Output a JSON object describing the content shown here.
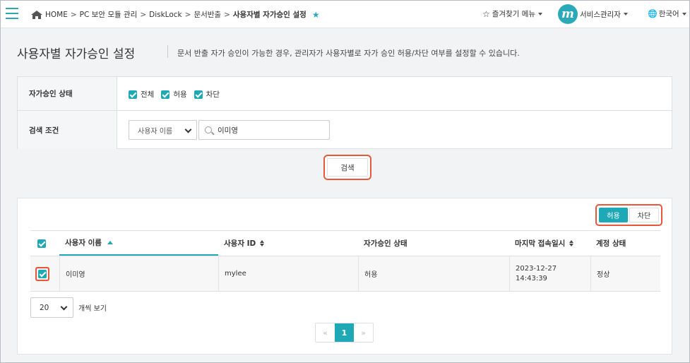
{
  "topbar": {
    "breadcrumb": [
      "HOME",
      "PC 보안 모듈 관리",
      "DiskLock",
      "문서반출",
      "사용자별 자가승인 설정"
    ],
    "breadcrumb_sep": ">",
    "favorites_label": "즐겨찾기 메뉴",
    "user_label": "서비스관리자",
    "avatar_letter": "m",
    "language_label": "한국어"
  },
  "page": {
    "title": "사용자별 자가승인 설정",
    "description": "문서 반출 자가 승인이 가능한 경우, 관리자가 사용자별로 자가 승인 허용/차단 여부를 설정할 수 있습니다."
  },
  "filter": {
    "status_label": "자가승인 상태",
    "status_options": [
      {
        "label": "전체",
        "checked": true
      },
      {
        "label": "허용",
        "checked": true
      },
      {
        "label": "차단",
        "checked": true
      }
    ],
    "condition_label": "검색 조건",
    "condition_select": "사용자 이름",
    "search_value": "이미영",
    "search_button": "검색"
  },
  "results": {
    "allow_button": "허용",
    "block_button": "차단",
    "columns": [
      "사용자 이름",
      "사용자 ID",
      "자가승인 상태",
      "마지막 접속일시",
      "계정 상태"
    ],
    "rows": [
      {
        "name": "이미영",
        "id": "mylee",
        "status": "허용",
        "last_login_date": "2023-12-27",
        "last_login_time": "14:43:39",
        "account": "정상",
        "checked": true
      }
    ],
    "page_size": "20",
    "page_size_label": "개씩 보기",
    "pager": {
      "prev": "«",
      "current": "1",
      "next": "»"
    }
  },
  "colors": {
    "accent": "#1fa9b7",
    "highlight": "#e8573a"
  }
}
